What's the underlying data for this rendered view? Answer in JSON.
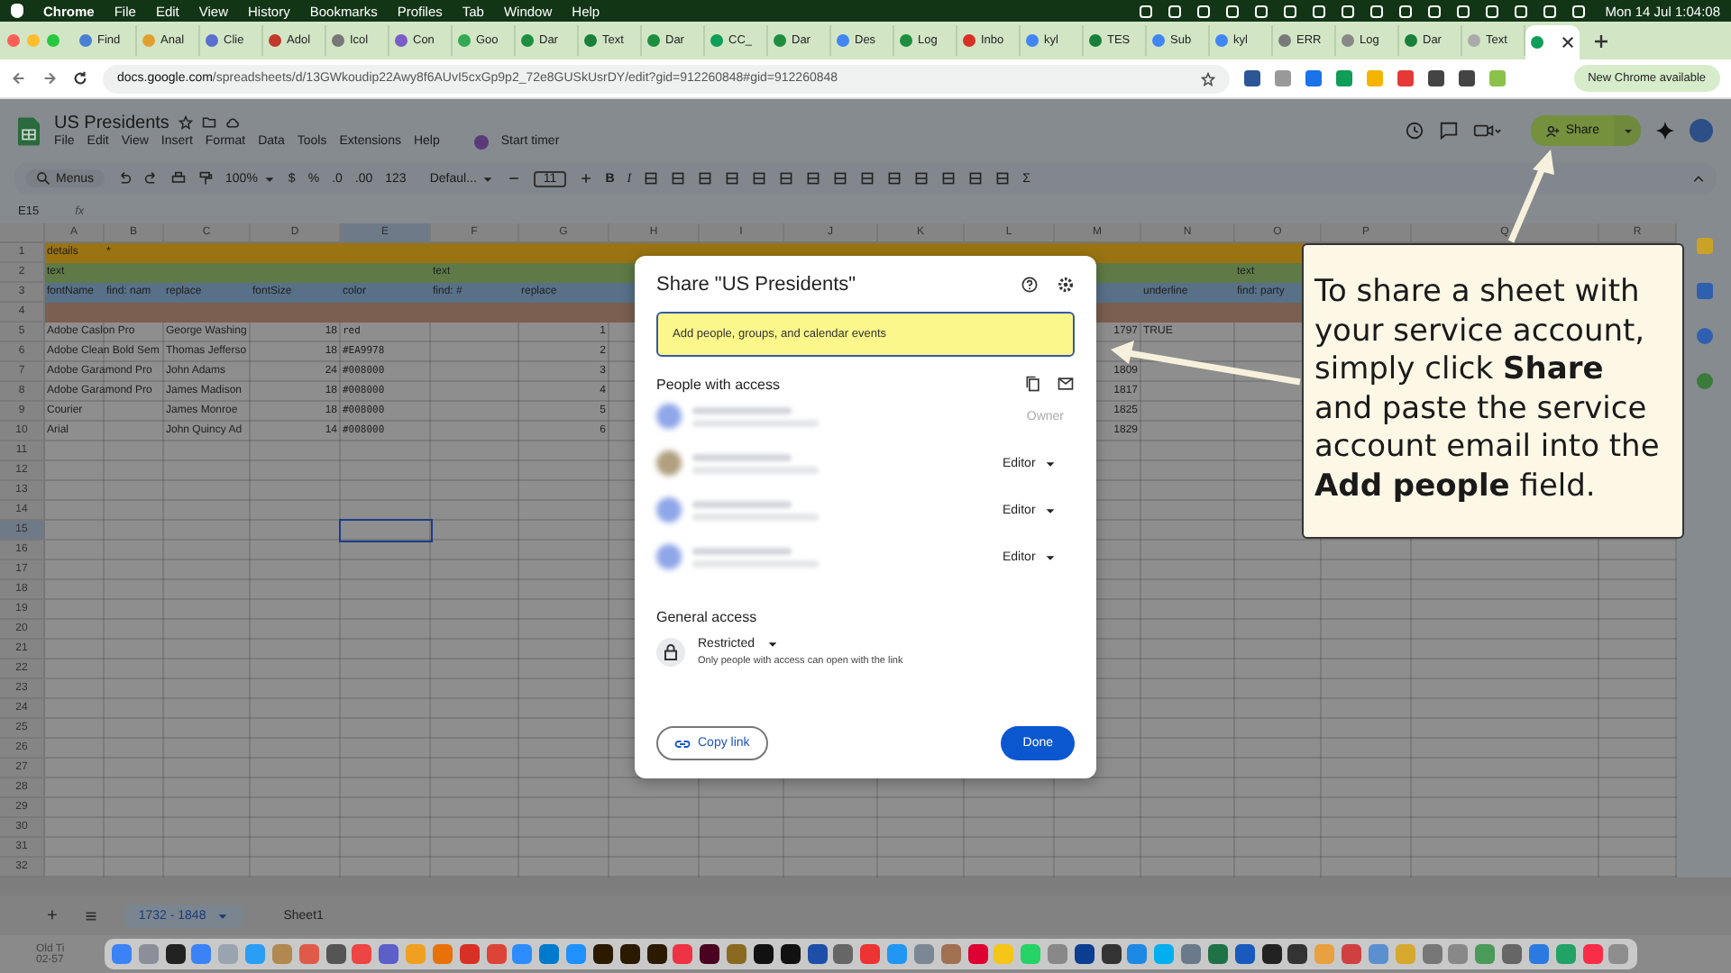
{
  "menubar": {
    "app": "Chrome",
    "items": [
      "File",
      "Edit",
      "View",
      "History",
      "Bookmarks",
      "Profiles",
      "Tab",
      "Window",
      "Help"
    ],
    "clock": "Mon 14 Jul 1:04:08"
  },
  "tabs": [
    {
      "title": "Find",
      "selected": false
    },
    {
      "title": "Anal",
      "selected": false
    },
    {
      "title": "Clie",
      "selected": false
    },
    {
      "title": "Adol",
      "selected": false
    },
    {
      "title": "Icol",
      "selected": false
    },
    {
      "title": "Con",
      "selected": false
    },
    {
      "title": "Goo",
      "selected": false
    },
    {
      "title": "Dar",
      "selected": false
    },
    {
      "title": "Text",
      "selected": false
    },
    {
      "title": "Dar",
      "selected": false
    },
    {
      "title": "CC_",
      "selected": false
    },
    {
      "title": "Dar",
      "selected": false
    },
    {
      "title": "Des",
      "selected": false
    },
    {
      "title": "Log",
      "selected": false
    },
    {
      "title": "Inbo",
      "selected": false
    },
    {
      "title": "kyl",
      "selected": false
    },
    {
      "title": "TES",
      "selected": false
    },
    {
      "title": "Sub",
      "selected": false
    },
    {
      "title": "kyl",
      "selected": false
    },
    {
      "title": "ERR",
      "selected": false
    },
    {
      "title": "Log",
      "selected": false
    },
    {
      "title": "Dar",
      "selected": false
    },
    {
      "title": "Text",
      "selected": false
    },
    {
      "selected": true
    }
  ],
  "address_bar": {
    "url_host": "docs.google.com",
    "url_path": "/spreadsheets/d/13GWkoudip22Awy8f6AUvI5cxGp9p2_72e8GUSkUsrDY/edit?gid=912260848#gid=912260848",
    "update_button": "New Chrome available"
  },
  "sheets": {
    "title": "US Presidents",
    "menu": [
      "File",
      "Edit",
      "View",
      "Insert",
      "Format",
      "Data",
      "Tools",
      "Extensions",
      "Help"
    ],
    "timer": "Start timer",
    "share": "Share"
  },
  "toolbar": {
    "menus": "Menus",
    "zoom": "100%",
    "currency": "$",
    "percent": "%",
    "decrease_decimals": ".0",
    "increase_decimals": ".00",
    "number_format": "123",
    "font": "Defaul...",
    "font_size": "11",
    "bold": "B",
    "italic": "I",
    "functions": "Σ"
  },
  "formula_bar": {
    "name_box": "E15",
    "fx": "fx"
  },
  "columns": [
    {
      "letter": "A",
      "selected": false
    },
    {
      "letter": "B",
      "selected": false
    },
    {
      "letter": "C",
      "selected": false
    },
    {
      "letter": "D",
      "selected": false
    },
    {
      "letter": "E",
      "selected": true
    },
    {
      "letter": "F",
      "selected": false
    },
    {
      "letter": "G",
      "selected": false
    },
    {
      "letter": "H",
      "selected": false
    },
    {
      "letter": "I",
      "selected": false
    },
    {
      "letter": "J",
      "selected": false
    },
    {
      "letter": "K",
      "selected": false
    },
    {
      "letter": "L",
      "selected": false
    },
    {
      "letter": "M",
      "selected": false
    },
    {
      "letter": "N",
      "selected": false
    },
    {
      "letter": "O",
      "selected": false
    },
    {
      "letter": "P",
      "selected": false
    },
    {
      "letter": "Q",
      "selected": false
    },
    {
      "letter": "R",
      "selected": false
    }
  ],
  "rows": [
    {
      "number": "1",
      "selected": false,
      "color": "#9a7412",
      "cells": [
        "details",
        "*"
      ]
    },
    {
      "number": "2",
      "selected": false,
      "color": "#5f7a46",
      "cells": [
        "text",
        null,
        null,
        null,
        null,
        "text",
        null,
        null,
        null,
        null,
        null,
        null,
        null,
        null,
        "text"
      ]
    },
    {
      "number": "3",
      "selected": false,
      "color": "#587189",
      "cells": [
        "fontName",
        "find: nam",
        "replace",
        "fontSize",
        "color",
        "find: #",
        "replace",
        null,
        null,
        null,
        null,
        null,
        null,
        "underline",
        "find: party"
      ]
    },
    {
      "number": "4",
      "selected": false,
      "color": "#7b5f50",
      "cells": []
    },
    {
      "number": "5",
      "selected": false,
      "cells": [
        "Adobe Caslon Pro",
        null,
        "George Washing",
        "18",
        "red",
        null,
        "1",
        null,
        null,
        null,
        null,
        null,
        "1797",
        "TRUE"
      ]
    },
    {
      "number": "6",
      "selected": false,
      "cells": [
        "Adobe Clean Bold Sem",
        null,
        "Thomas Jefferso",
        "18",
        "#EA9978",
        null,
        "2"
      ]
    },
    {
      "number": "7",
      "selected": false,
      "cells": [
        "Adobe Garamond Pro",
        null,
        "John Adams",
        "24",
        "#008000",
        null,
        "3",
        null,
        null,
        null,
        null,
        null,
        "1809"
      ]
    },
    {
      "number": "8",
      "selected": false,
      "cells": [
        "Adobe Garamond Pro",
        null,
        "James Madison",
        "18",
        "#008000",
        null,
        "4",
        null,
        null,
        null,
        null,
        null,
        "1817"
      ]
    },
    {
      "number": "9",
      "selected": false,
      "cells": [
        "Courier",
        null,
        "James Monroe",
        "18",
        "#008000",
        null,
        "5",
        null,
        null,
        null,
        null,
        null,
        "1825"
      ]
    },
    {
      "number": "10",
      "selected": false,
      "cells": [
        "Arial",
        null,
        "John Quincy Ad",
        "14",
        "#008000",
        null,
        "6",
        null,
        null,
        null,
        null,
        null,
        "1829"
      ]
    },
    {
      "number": "11",
      "selected": false,
      "cells": []
    },
    {
      "number": "12",
      "selected": false,
      "cells": []
    },
    {
      "number": "13",
      "selected": false,
      "cells": []
    },
    {
      "number": "14",
      "selected": false,
      "cells": []
    },
    {
      "number": "15",
      "selected": true,
      "cells": []
    },
    {
      "number": "16",
      "selected": false,
      "cells": []
    },
    {
      "number": "17",
      "selected": false,
      "cells": []
    },
    {
      "number": "18",
      "selected": false,
      "cells": []
    },
    {
      "number": "19",
      "selected": false,
      "cells": []
    },
    {
      "number": "20",
      "selected": false,
      "cells": []
    },
    {
      "number": "21",
      "selected": false,
      "cells": []
    },
    {
      "number": "22",
      "selected": false,
      "cells": []
    },
    {
      "number": "23",
      "selected": false,
      "cells": []
    },
    {
      "number": "24",
      "selected": false,
      "cells": []
    },
    {
      "number": "25",
      "selected": false,
      "cells": []
    },
    {
      "number": "26",
      "selected": false,
      "cells": []
    },
    {
      "number": "27",
      "selected": false,
      "cells": []
    },
    {
      "number": "28",
      "selected": false,
      "cells": []
    },
    {
      "number": "29",
      "selected": false,
      "cells": []
    },
    {
      "number": "30",
      "selected": false,
      "cells": []
    },
    {
      "number": "31",
      "selected": false,
      "cells": []
    },
    {
      "number": "32",
      "selected": false,
      "cells": []
    }
  ],
  "sheet_tabs": {
    "add": "+",
    "tabs": [
      {
        "name": "1732 - 1848",
        "selected": true
      },
      {
        "name": "Sheet1",
        "selected": false
      }
    ]
  },
  "dialog": {
    "title": "Share \"US Presidents\"",
    "field": {
      "placeholder": "Add people, groups, and calendar events"
    },
    "people_heading": "People with access",
    "people": [
      {
        "role": "Owner",
        "disabled": true
      },
      {
        "role": "Editor",
        "disabled": false
      },
      {
        "role": "Editor",
        "disabled": false
      },
      {
        "role": "Editor",
        "disabled": false
      }
    ],
    "general_heading": "General access",
    "access": "Restricted",
    "access_note": "Only people with access can open with the link",
    "copy_link": "Copy link",
    "done": "Done"
  },
  "callout": {
    "text": "To share a sheet with your service account, simply click **Share** and paste the service account email into the **Add people** field."
  },
  "desktop": [
    "Old Ti",
    "02-57"
  ]
}
